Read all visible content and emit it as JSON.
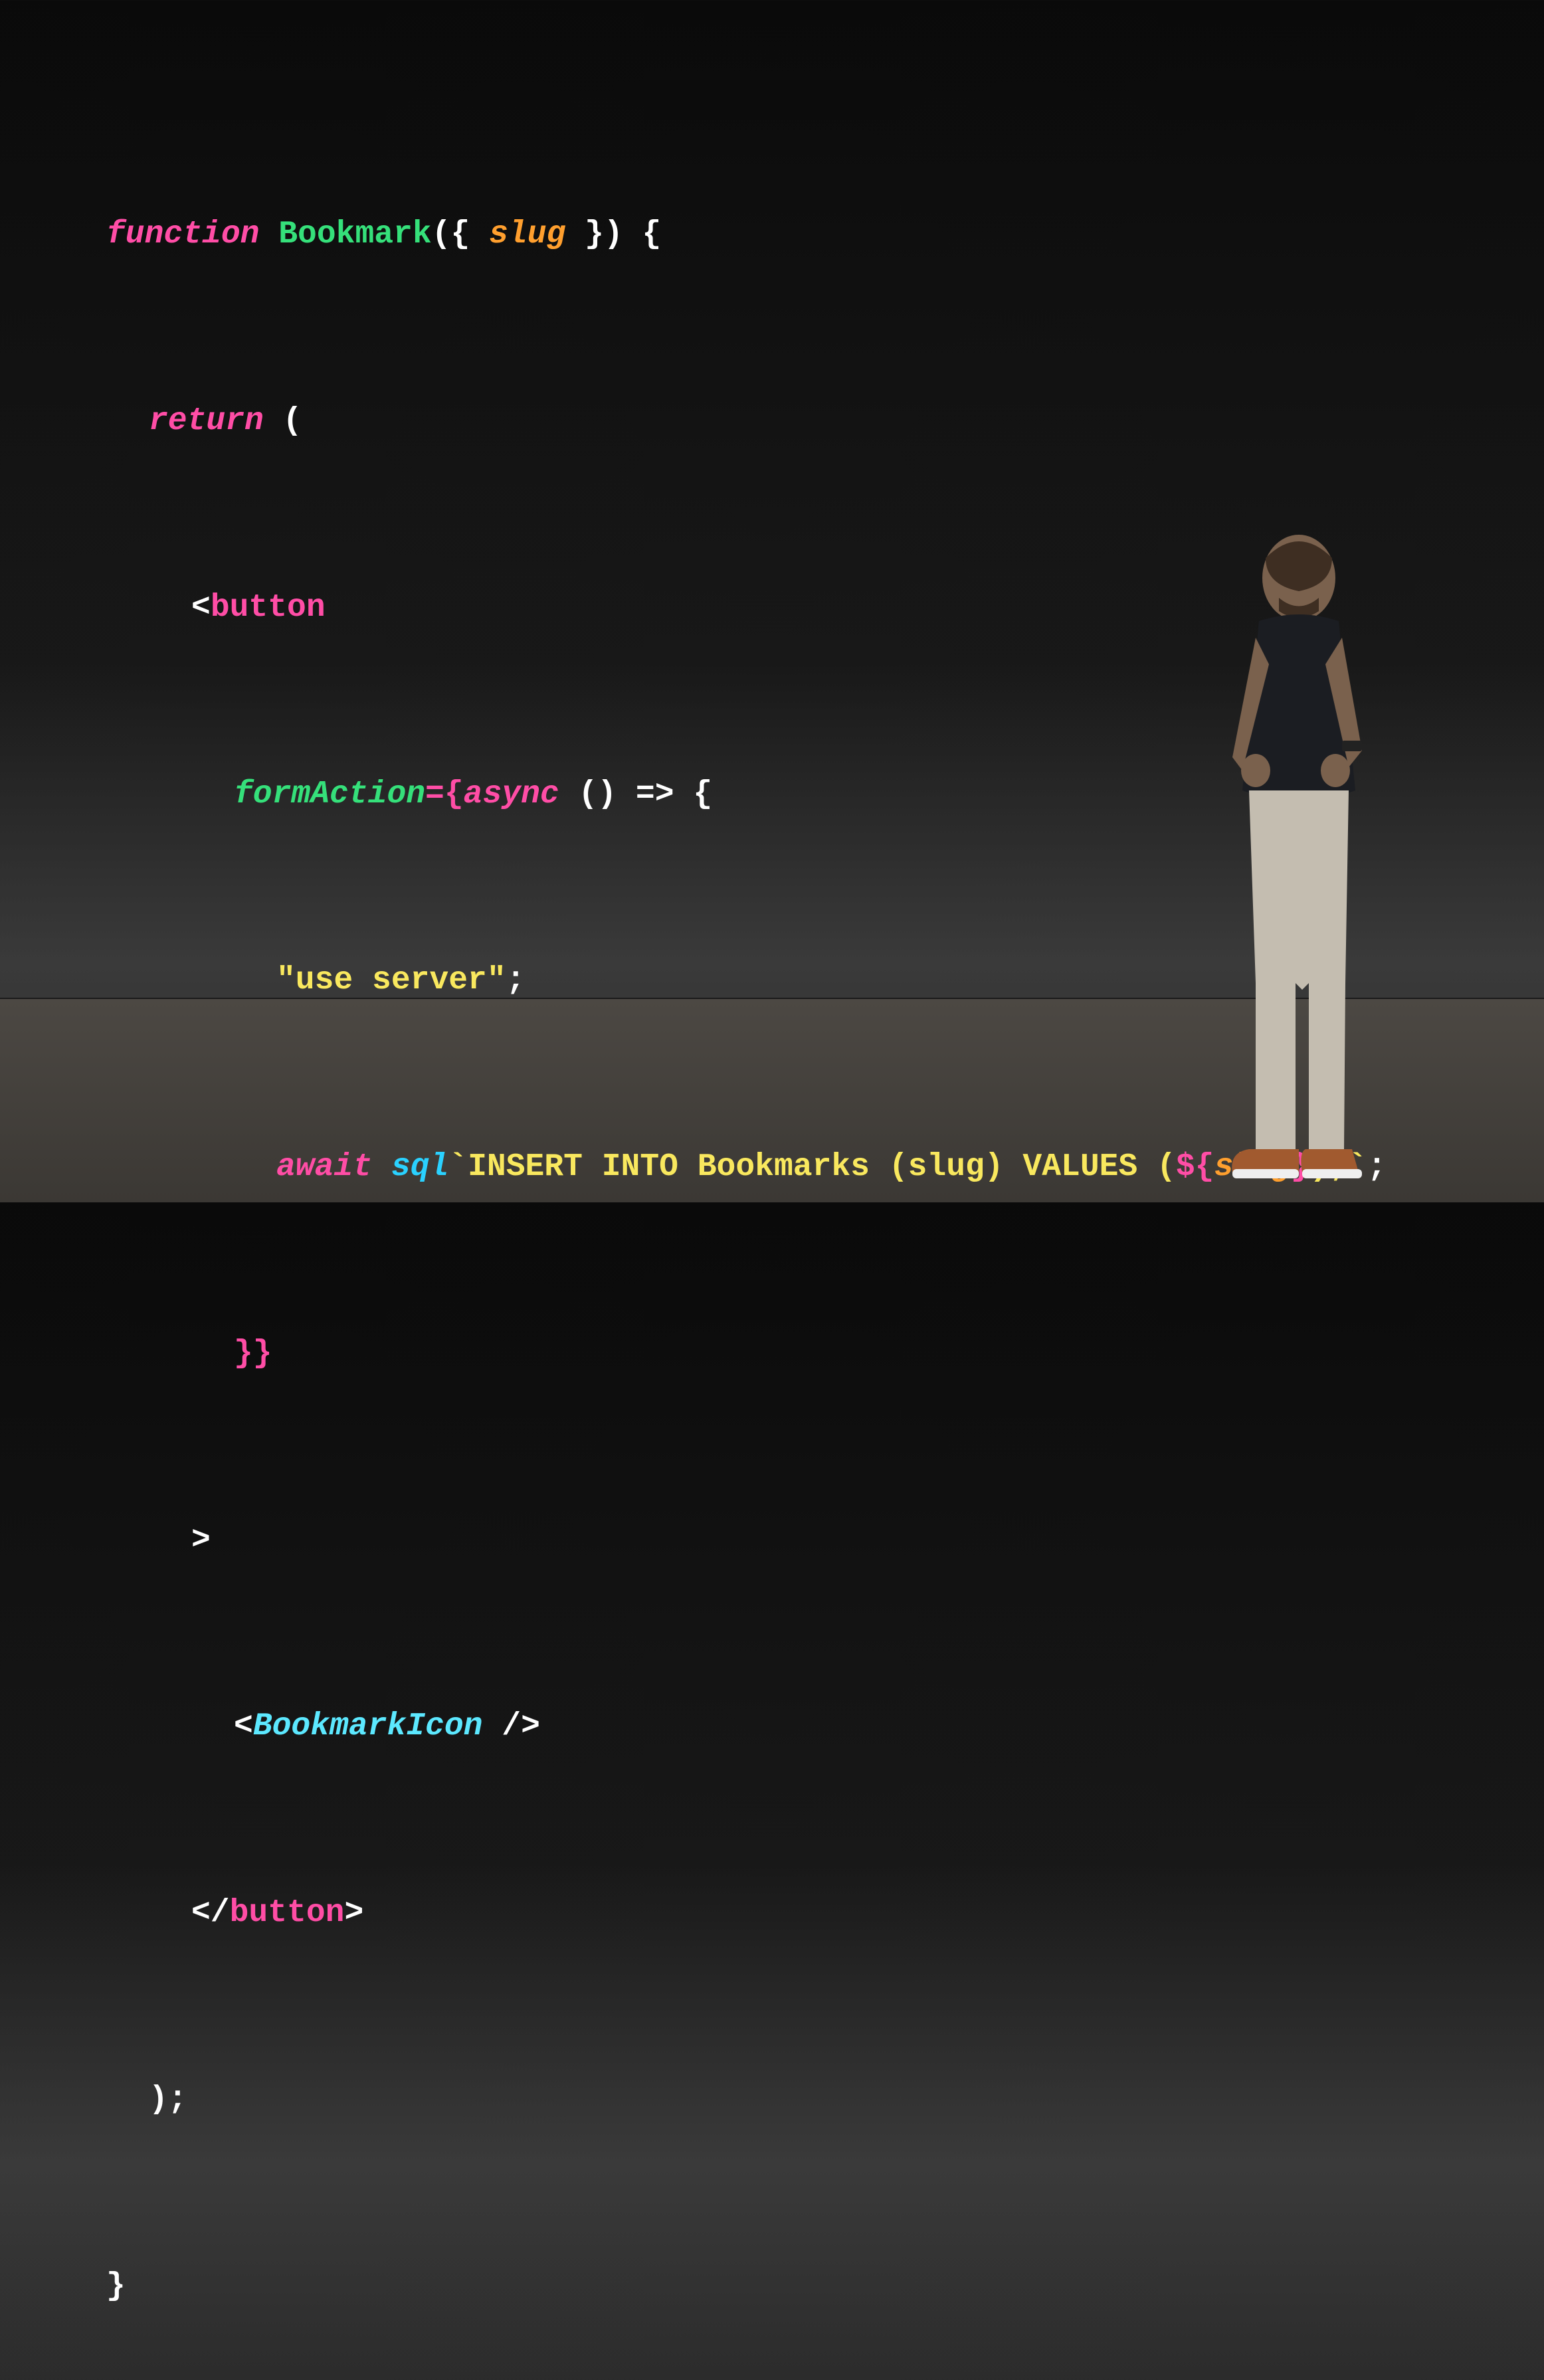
{
  "code": {
    "l1": {
      "kw": "function",
      "fn": "Bookmark",
      "open": "({",
      "param": "slug",
      "close": "}) {"
    },
    "l2": {
      "ret": "return",
      "paren": "("
    },
    "l3": {
      "lt": "<",
      "tag": "button"
    },
    "l4": {
      "attr": "formAction",
      "eq": "={",
      "async": "async",
      "arrow": "() => {"
    },
    "l5": {
      "str": "\"use server\"",
      "semi": ";"
    },
    "l6": {
      "await": "await",
      "sql": "sql",
      "tick": "`",
      "query": "INSERT INTO Bookmarks (slug) VALUES (",
      "interp_open": "${",
      "var": "slug",
      "interp_close": "}",
      "tail": ");",
      "tick2": "`",
      "semi": ";"
    },
    "l7": {
      "close": "}}"
    },
    "l8": {
      "gt": ">"
    },
    "l9": {
      "lt": "<",
      "comp": "BookmarkIcon",
      "close": " />"
    },
    "l10": {
      "lt": "</",
      "tag": "button",
      "gt": ">"
    },
    "l11": {
      "close": ");"
    },
    "l12": {
      "brace": "}"
    }
  }
}
